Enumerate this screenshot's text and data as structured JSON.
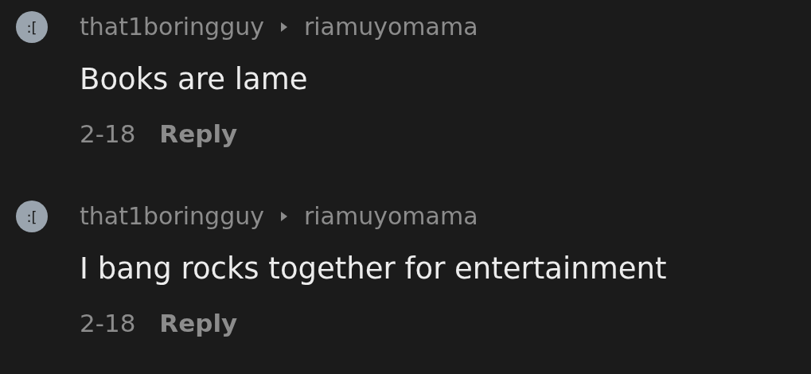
{
  "comments": [
    {
      "avatar_text": ":[",
      "author": "that1boringguy",
      "reply_to": "riamuyomama",
      "text": "Books are lame",
      "date": "2-18",
      "action": "Reply"
    },
    {
      "avatar_text": ":[",
      "author": "that1boringguy",
      "reply_to": "riamuyomama",
      "text": "I bang rocks together for entertainment",
      "date": "2-18",
      "action": "Reply"
    }
  ]
}
